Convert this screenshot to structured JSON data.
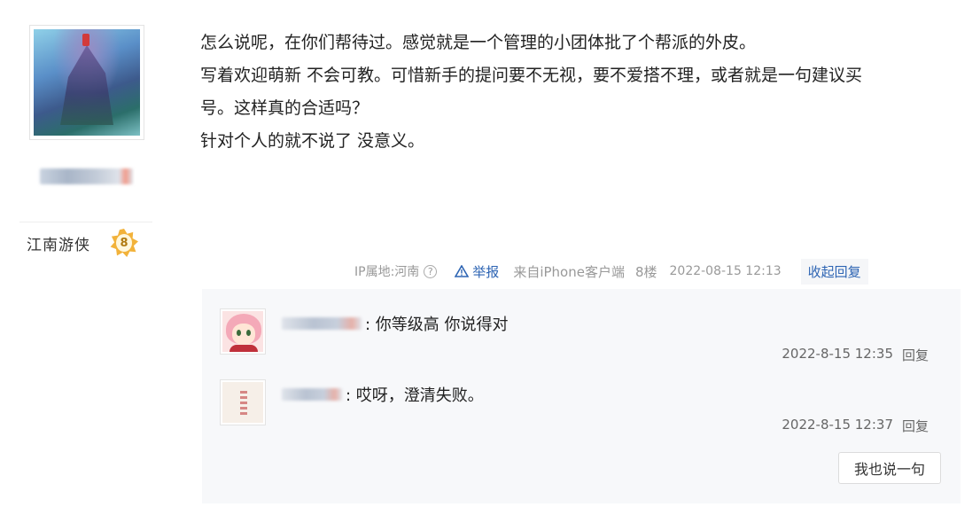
{
  "author": {
    "rank_title": "江南游侠",
    "level": "8"
  },
  "post": {
    "lines": [
      "怎么说呢，在你们帮待过。感觉就是一个管理的小团体批了个帮派的外皮。",
      "写着欢迎萌新 不会可教。可惜新手的提问要不无视，要不爱搭不理，或者就是一句建议买",
      "号。这样真的合适吗？",
      "针对个人的就不说了 没意义。"
    ]
  },
  "meta": {
    "ip": "IP属地:河南",
    "help_icon": "?",
    "report_label": "举报",
    "source": "来自iPhone客户端",
    "floor": "8楼",
    "time": "2022-08-15 12:13",
    "collapse_label": "收起回复"
  },
  "replies": [
    {
      "text": ": 你等级高 你说得对",
      "time": "2022-8-15 12:35",
      "reply_label": "回复"
    },
    {
      "text": ": 哎呀，澄清失败。",
      "time": "2022-8-15 12:37",
      "reply_label": "回复"
    }
  ],
  "say_button_label": "我也说一句",
  "colors": {
    "link": "#2d64b3",
    "meta_gray": "#999999",
    "reply_bg": "#f7f8fa",
    "badge": "#f2b23a"
  },
  "icons": {
    "help": "help-icon",
    "report": "warning-icon",
    "badge": "level-badge-icon"
  }
}
